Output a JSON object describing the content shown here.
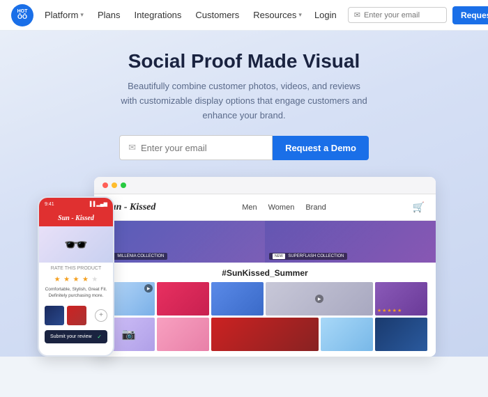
{
  "nav": {
    "logo_text": "HOT\nOO",
    "items": [
      {
        "label": "Platform",
        "has_dropdown": true
      },
      {
        "label": "Plans",
        "has_dropdown": false
      },
      {
        "label": "Integrations",
        "has_dropdown": false
      },
      {
        "label": "Customers",
        "has_dropdown": false
      },
      {
        "label": "Resources",
        "has_dropdown": true
      }
    ],
    "login_label": "Login",
    "email_placeholder": "Enter your email",
    "demo_button": "Request a demo"
  },
  "hero": {
    "title": "Social Proof Made Visual",
    "subtitle": "Beautifully combine customer photos, videos, and reviews with customizable display options that engage customers and enhance your brand.",
    "email_placeholder": "Enter your email",
    "cta_button": "Request a Demo"
  },
  "site": {
    "logo": "Sun - Kissed",
    "nav_links": [
      "Men",
      "Women",
      "Brand"
    ],
    "hashtag": "#SunKissed_Summer",
    "banner1_badge": "MILLENIA COLLECTION",
    "banner2_badge": "SUPERFLASH COLLECTION"
  },
  "phone": {
    "time": "9:41",
    "store_name": "Sun - Kissed",
    "rate_label": "RATE THIS PRODUCT",
    "review_text": "Comfortable, Stylish, Great Fit.\nDefinitely purchasing more.",
    "submit_label": "Submit your review",
    "submit_icon": "✓"
  }
}
